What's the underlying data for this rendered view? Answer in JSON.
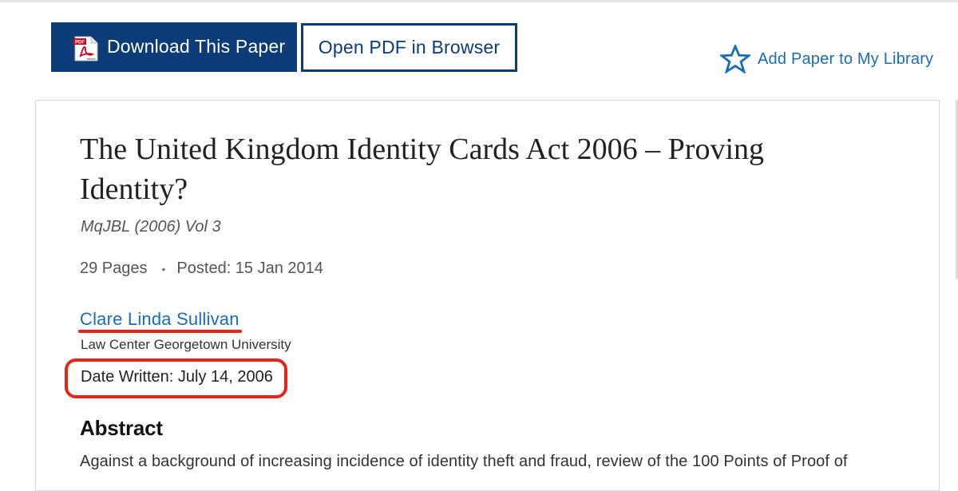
{
  "toolbar": {
    "download_label": "Download This Paper",
    "download_icon": "pdf-icon",
    "pdf_icon_text": "PDF",
    "pdf_icon_brand": "Adobe",
    "open_pdf_label": "Open PDF in Browser",
    "add_library_label": "Add Paper to My Library",
    "add_library_icon": "star-outline-icon"
  },
  "paper": {
    "title": "The United Kingdom Identity Cards Act 2006 – Proving Identity?",
    "journal": "MqJBL (2006) Vol 3",
    "pages": "29 Pages",
    "separator": "•",
    "posted": "Posted: 15 Jan 2014",
    "author": "Clare Linda Sullivan",
    "affiliation": "Law Center Georgetown University",
    "date_written": "Date Written: July 14, 2006"
  },
  "abstract": {
    "heading": "Abstract",
    "text": "Against a background of increasing incidence of identity theft and fraud, review of the 100 Points of Proof of"
  },
  "colors": {
    "brand_navy": "#0c3c78",
    "link_blue": "#1a6bb8",
    "annotation_red": "#e5251a"
  }
}
